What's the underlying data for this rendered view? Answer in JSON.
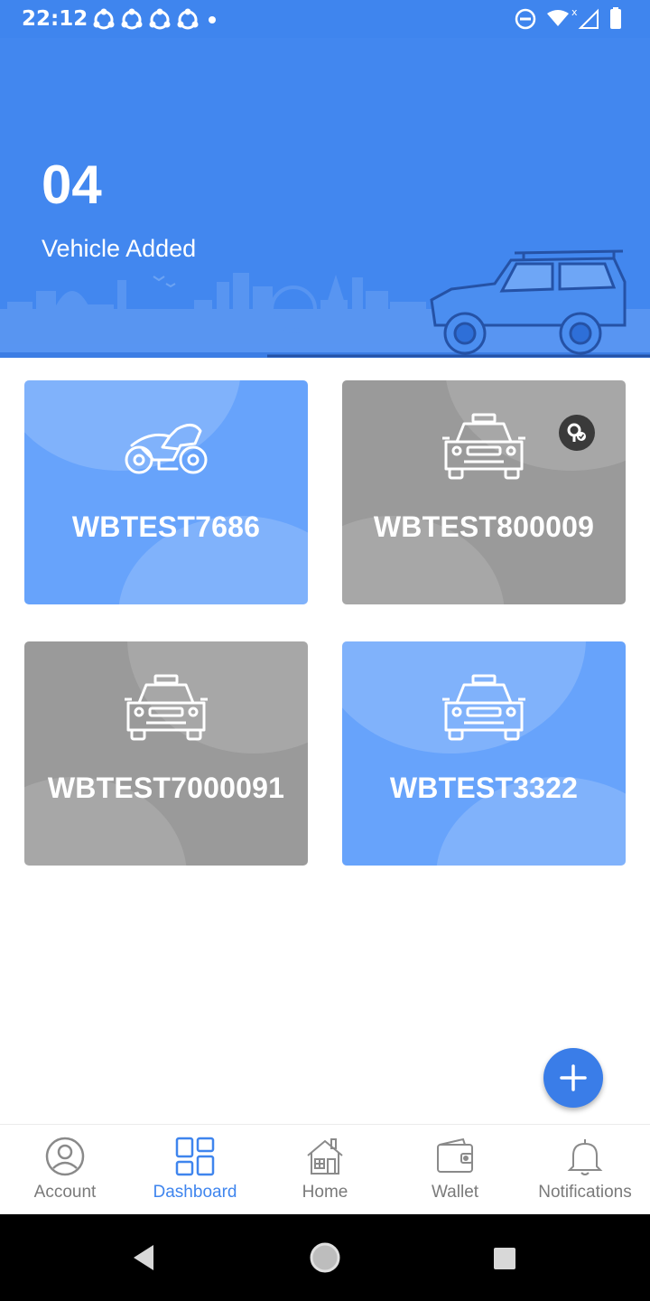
{
  "status_bar": {
    "time": "22:12",
    "notification_icons": [
      "app-notification-icon",
      "app-notification-icon",
      "app-notification-icon",
      "app-notification-icon",
      "dot-icon"
    ],
    "right_icons": [
      "do-not-disturb-icon",
      "wifi-icon",
      "signal-icon",
      "battery-icon"
    ]
  },
  "hero": {
    "count": "04",
    "label": "Vehicle Added",
    "background_color": "#4287ef"
  },
  "vehicles": [
    {
      "plate": "WBTEST7686",
      "icon": "motorcycle-icon",
      "state": "blue"
    },
    {
      "plate": "WBTEST800009",
      "icon": "car-icon",
      "state": "gray",
      "badge": "key-badge-icon"
    },
    {
      "plate": "WBTEST7000091",
      "icon": "car-icon",
      "state": "gray"
    },
    {
      "plate": "WBTEST3322",
      "icon": "car-icon",
      "state": "blue"
    }
  ],
  "fab": {
    "icon": "plus-icon"
  },
  "bottom_nav": {
    "items": [
      {
        "label": "Account",
        "icon": "account-icon",
        "active": false
      },
      {
        "label": "Dashboard",
        "icon": "dashboard-icon",
        "active": true
      },
      {
        "label": "Home",
        "icon": "home-icon",
        "active": false
      },
      {
        "label": "Wallet",
        "icon": "wallet-icon",
        "active": false
      },
      {
        "label": "Notifications",
        "icon": "bell-icon",
        "active": false
      }
    ]
  },
  "colors": {
    "primary": "#3f85ee",
    "card_blue": "#67a3fb",
    "card_gray": "#9a9a9a",
    "nav_inactive": "#7a7a7a"
  }
}
